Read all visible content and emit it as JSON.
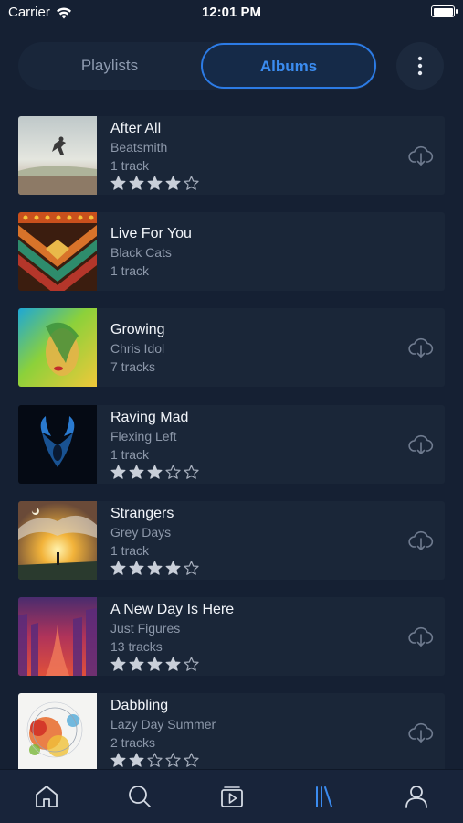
{
  "status_bar": {
    "carrier": "Carrier",
    "time": "12:01 PM",
    "battery_level": 1.0
  },
  "segmented": {
    "tabs": [
      {
        "label": "Playlists",
        "selected": false
      },
      {
        "label": "Albums",
        "selected": true
      }
    ]
  },
  "more_icon": "more-vertical-icon",
  "download_icon": "cloud-download-icon",
  "colors": {
    "background": "#152033",
    "card": "#1a2638",
    "accent": "#3b8cf0",
    "muted_text": "#8d98aa"
  },
  "albums": [
    {
      "title": "After All",
      "artist": "Beatsmith",
      "tracks": "1 track",
      "rating": 4,
      "downloadable": true
    },
    {
      "title": "Live For You",
      "artist": "Black Cats",
      "tracks": "1 track",
      "rating": null,
      "downloadable": false
    },
    {
      "title": "Growing",
      "artist": "Chris Idol",
      "tracks": "7 tracks",
      "rating": null,
      "downloadable": true
    },
    {
      "title": "Raving Mad",
      "artist": "Flexing Left",
      "tracks": "1 track",
      "rating": 3,
      "downloadable": true
    },
    {
      "title": "Strangers",
      "artist": "Grey Days",
      "tracks": "1 track",
      "rating": 4,
      "downloadable": true
    },
    {
      "title": "A New Day Is Here",
      "artist": "Just Figures",
      "tracks": "13 tracks",
      "rating": 4,
      "downloadable": true
    },
    {
      "title": "Dabbling",
      "artist": "Lazy Day Summer",
      "tracks": "2 tracks",
      "rating": 2,
      "downloadable": true
    }
  ],
  "tab_bar": {
    "items": [
      {
        "icon": "home-icon",
        "selected": false
      },
      {
        "icon": "search-icon",
        "selected": false
      },
      {
        "icon": "now-playing-icon",
        "selected": false
      },
      {
        "icon": "library-icon",
        "selected": true
      },
      {
        "icon": "profile-icon",
        "selected": false
      }
    ]
  }
}
